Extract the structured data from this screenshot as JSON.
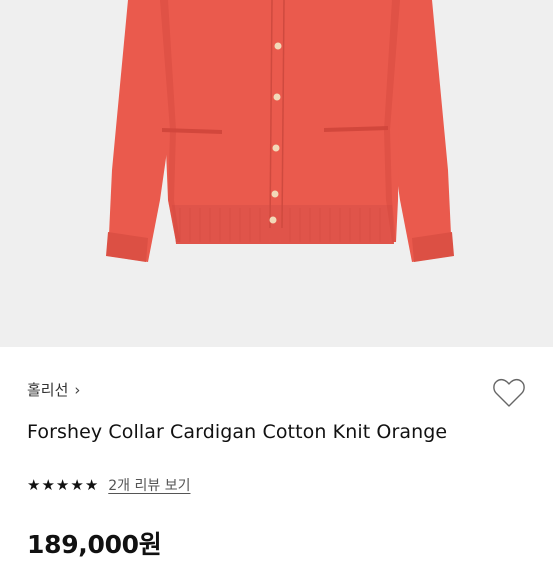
{
  "product": {
    "image_alt": "",
    "brand": "홀리선",
    "brand_chevron": "›",
    "title": "Forshey Collar Cardigan Cotton Knit Orange",
    "rating_stars": 5,
    "review_link": "2개 리뷰 보기",
    "price": "189,000원"
  },
  "colors": {
    "image_background": "#efefef",
    "cardigan": "#ea5a4d",
    "cardigan_shadow": "#d2473c",
    "button": "#f2d9b8",
    "text": "#111111"
  },
  "icons": {
    "wishlist": "heart-outline-icon",
    "star": "star-filled-icon"
  }
}
